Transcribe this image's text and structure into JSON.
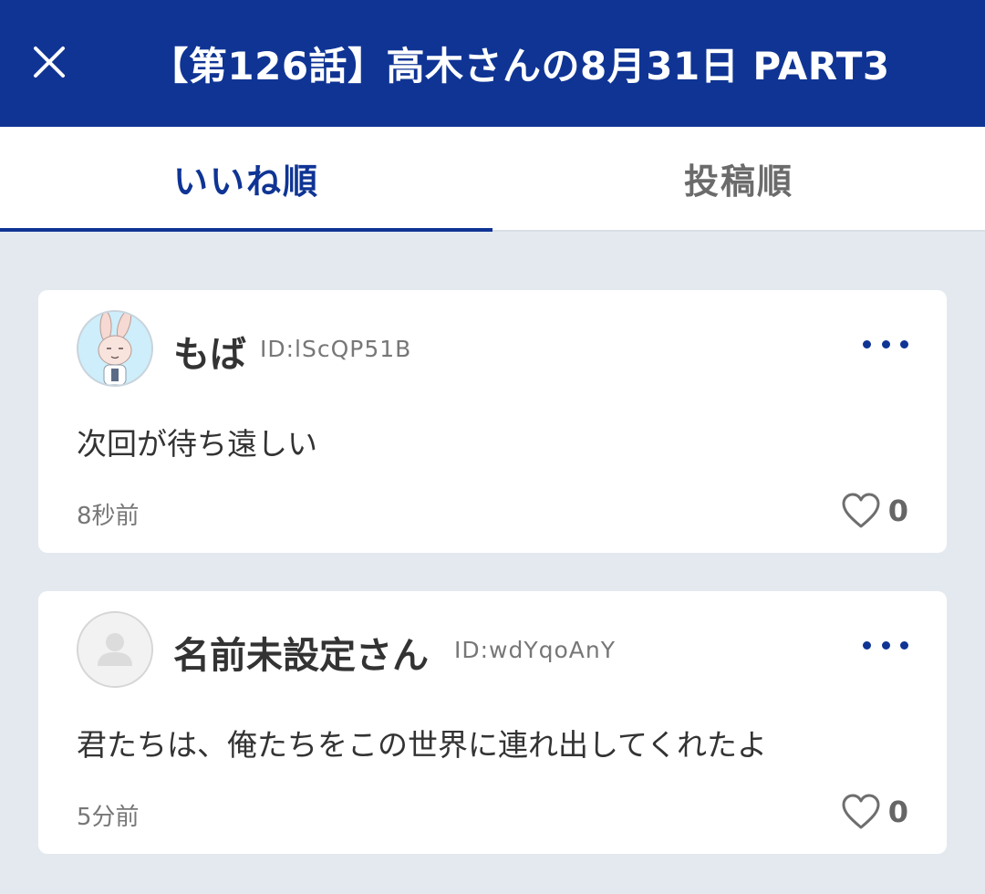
{
  "header": {
    "title": "【第126話】高木さんの8月31日 PART3",
    "close_icon": "close-icon",
    "background": "#0f3494"
  },
  "tabs": [
    {
      "label": "いいね順",
      "active": true
    },
    {
      "label": "投稿順",
      "active": false
    }
  ],
  "comments": [
    {
      "username": "もば",
      "user_id": "ID:lScQP51B",
      "avatar": "rabbit-avatar",
      "text": "次回が待ち遠しい",
      "time": "8秒前",
      "likes": "0"
    },
    {
      "username": "名前未設定さん",
      "user_id": "ID:wdYqoAnY",
      "avatar": "default-user-avatar",
      "text": "君たちは、俺たちをこの世界に連れ出してくれたよ",
      "time": "5分前",
      "likes": "0"
    }
  ],
  "colors": {
    "accent": "#0f3494",
    "page_background": "#e3e9ef",
    "inactive_tab": "#6b6b6b"
  }
}
